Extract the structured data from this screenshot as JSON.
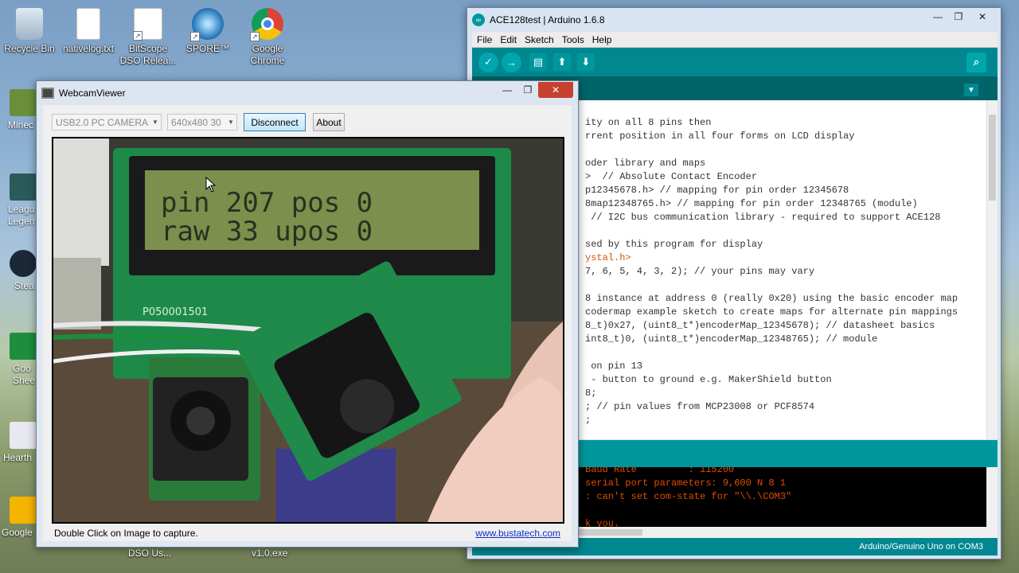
{
  "desktop": {
    "icons": [
      {
        "label": "Recycle Bin",
        "icon": "recycle-bin-icon"
      },
      {
        "label": "nativelog.txt",
        "icon": "text-file-icon"
      },
      {
        "label": "BitScope DSO Relea...",
        "icon": "pdf-icon"
      },
      {
        "label": "SPORE™",
        "icon": "spore-icon"
      },
      {
        "label": "Google Chrome",
        "icon": "chrome-icon"
      }
    ],
    "partial_icons": [
      "Minec",
      "Leagu Legen",
      "Stea",
      "Goo Shee",
      "Hearth",
      "Google"
    ],
    "bottom_labels": [
      "DSO Us...",
      "v1.0.exe"
    ]
  },
  "webcam": {
    "title": "WebcamViewer",
    "camera_select": "USB2.0 PC CAMERA",
    "resolution_select": "640x480 30",
    "disconnect_label": "Disconnect",
    "about_label": "About",
    "lcd_line1": "pin 207 pos  0",
    "lcd_line2": "raw 33  upos 0",
    "board_label": "P050001501",
    "caption": "Double Click on Image to capture.",
    "link": "www.bustatech.com"
  },
  "arduino": {
    "title": "ACE128test | Arduino 1.6.8",
    "menu": [
      "File",
      "Edit",
      "Sketch",
      "Tools",
      "Help"
    ],
    "code_lines": [
      "ity on all 8 pins then",
      "rrent position in all four forms on LCD display",
      "",
      "oder library and maps",
      ">  // Absolute Contact Encoder",
      "p12345678.h> // mapping for pin order 12345678",
      "8map12348765.h> // mapping for pin order 12348765 (module)",
      " // I2C bus communication library - required to support ACE128",
      "",
      "sed by this program for display",
      "ystal.h>",
      "7, 6, 5, 4, 3, 2); // your pins may vary",
      "",
      "8 instance at address 0 (really 0x20) using the basic encoder map",
      "codermap example sketch to create maps for alternate pin mappings",
      "8_t)0x27, (uint8_t*)encoderMap_12345678); // datasheet basics",
      "int8_t)0, (uint8_t*)encoderMap_12348765); // module",
      "",
      " on pin 13",
      " - button to ground e.g. MakerShield button",
      "8;",
      "; // pin values from MCP23008 or PCF8574",
      ";"
    ],
    "console_lines": [
      "Baud Rate         : 115200",
      "serial port parameters: 9,600 N 8 1",
      ": can't set com-state for \"\\\\.\\COM3\"",
      "",
      "k you."
    ],
    "status": "Arduino/Genuino Uno on COM3",
    "colors": {
      "teal": "#00979c",
      "dark_teal": "#006468",
      "console_text": "#e34c00"
    }
  }
}
